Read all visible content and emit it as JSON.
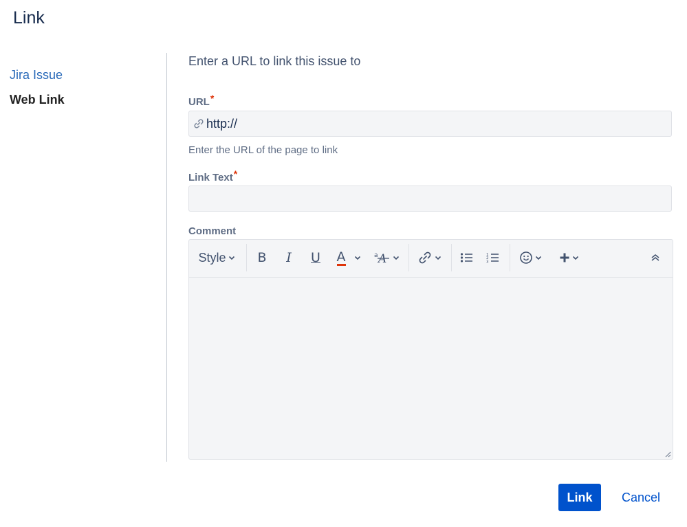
{
  "dialog": {
    "title": "Link"
  },
  "nav": {
    "items": [
      {
        "label": "Jira Issue"
      },
      {
        "label": "Web Link"
      }
    ]
  },
  "form": {
    "intro": "Enter a URL to link this issue to",
    "url": {
      "label": "URL",
      "required_mark": "*",
      "value": "http://",
      "help": "Enter the URL of the page to link"
    },
    "link_text": {
      "label": "Link Text",
      "required_mark": "*",
      "value": ""
    },
    "comment": {
      "label": "Comment",
      "value": ""
    }
  },
  "toolbar": {
    "style_label": "Style",
    "bold": "B",
    "italic": "I",
    "underline": "U",
    "text_color": "A",
    "text_color_underline": "#de350b",
    "icons": [
      "chevron-down-icon",
      "text-effects-icon",
      "link-icon",
      "bullet-list-icon",
      "numbered-list-icon",
      "emoji-icon",
      "plus-icon",
      "collapse-icon"
    ]
  },
  "actions": {
    "primary": "Link",
    "cancel": "Cancel"
  },
  "colors": {
    "primary": "#0052cc",
    "link": "#2768b8",
    "field_bg": "#f4f5f7",
    "required": "#de350b"
  }
}
